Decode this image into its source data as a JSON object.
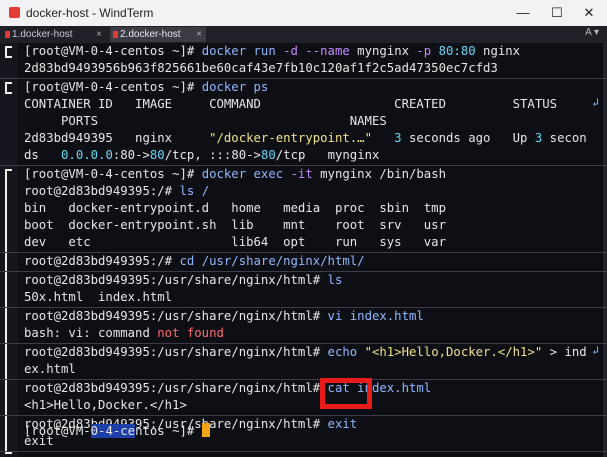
{
  "window": {
    "title": "docker-host - WindTerm",
    "min_label": "—",
    "max_label": "☐",
    "close_label": "✕"
  },
  "tabs": [
    {
      "label": "1.docker-host",
      "close": "×"
    },
    {
      "label": "2.docker-host",
      "close": "×"
    }
  ],
  "tab_tools": "A  ▾",
  "colors": {
    "prompt": "#e6e6e6",
    "command": "#8fb7ff",
    "option": "#c387ff",
    "number": "#69d6f5",
    "error": "#ff6b6b",
    "highlight": "#e81a1a",
    "cursor": "#f2a516"
  },
  "term": {
    "l1": {
      "prompt": "[root@VM-0-4-centos ~]# ",
      "cmd": "docker run ",
      "opt1": "-d --name ",
      "name": "mynginx ",
      "opt2": "-p ",
      "port": "80:80 ",
      "image": "nginx"
    },
    "l2": "2d83bd9493956b963f825661be60caf43e7fb10c120af1f2c5ad47350ec7cfd3",
    "l3": {
      "prompt": "[root@VM-0-4-centos ~]# ",
      "cmd": "docker ps"
    },
    "l4": "CONTAINER ID   IMAGE     COMMAND                  CREATED         STATUS",
    "l5": "     PORTS                                  NAMES",
    "l6": {
      "a": "2d83bd949395   nginx     ",
      "b": "\"/docker-entrypoint.…\"",
      "c": "   3 ",
      "d": "seconds ago   Up ",
      "e": "3",
      "f": " secon"
    },
    "l7": {
      "a": "ds   ",
      "b": "0.0.0.0",
      "c": ":80->",
      "d": "80",
      "e": "/tcp, :::80->",
      "f": "80",
      "g": "/tcp   mynginx"
    },
    "l8": {
      "prompt": "[root@VM-0-4-centos ~]# ",
      "cmd": "docker exec ",
      "opt": "-it ",
      "rest": "mynginx /bin/bash"
    },
    "l9": {
      "prompt": "root@2d83bd949395:/# ",
      "cmd": "ls /"
    },
    "l10": "bin   docker-entrypoint.d   home   media  proc  sbin  tmp",
    "l11": "boot  docker-entrypoint.sh  lib    mnt    root  srv   usr",
    "l12": "dev   etc                   lib64  opt    run   sys   var",
    "l13": {
      "prompt": "root@2d83bd949395:/# ",
      "cmd": "cd /usr/share/nginx/html/"
    },
    "l14": {
      "prompt": "root@2d83bd949395:/usr/share/nginx/html# ",
      "cmd": "ls"
    },
    "l15": "50x.html  index.html",
    "l16": {
      "prompt": "root@2d83bd949395:/usr/share/nginx/html# ",
      "cmd": "vi index.html"
    },
    "l17": {
      "a": "bash: vi: command ",
      "b": "not found"
    },
    "l18": {
      "prompt": "root@2d83bd949395:/usr/share/nginx/html# ",
      "cmd": "echo ",
      "str": "\"<h1>Hello,Docker.</h1>\"",
      "rest": " > ind"
    },
    "l19": "ex.html",
    "l20": {
      "prompt": "root@2d83bd949395:/usr/share/nginx/html# ",
      "cmd": "cat index.html"
    },
    "l21": "<h1>Hello,Docker.</h1>",
    "l22": {
      "prompt": "root@2d83bd949395:/usr/share/nginx/html# ",
      "cmd": "exit"
    },
    "l23": "exit",
    "l24": {
      "a": "[root@VM-",
      "b": "0-4-ce",
      "c": "ntos ~]# "
    }
  }
}
